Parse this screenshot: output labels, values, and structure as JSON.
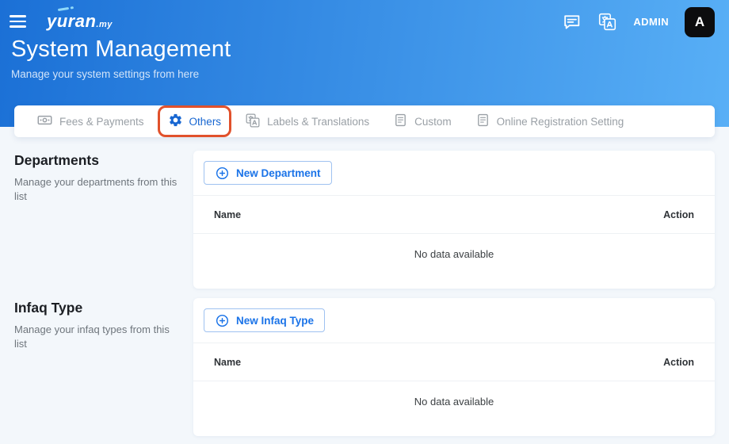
{
  "header": {
    "logo_text": "yuran",
    "logo_suffix": ".my",
    "admin_label": "ADMIN",
    "avatar_letter": "A",
    "title": "System Management",
    "subtitle": "Manage your system settings from here",
    "icons": [
      "hamburger-icon",
      "chat-icon",
      "translate-icon"
    ]
  },
  "tabs": [
    {
      "label": "Fees & Payments",
      "icon": "banknote-icon",
      "active": false
    },
    {
      "label": "Others",
      "icon": "gear-icon",
      "active": true,
      "highlighted": true
    },
    {
      "label": "Labels & Translations",
      "icon": "translate-icon",
      "active": false
    },
    {
      "label": "Custom",
      "icon": "document-icon",
      "active": false
    },
    {
      "label": "Online Registration Setting",
      "icon": "document-icon",
      "active": false
    }
  ],
  "sections": [
    {
      "title": "Departments",
      "description": "Manage your departments from this list",
      "button_label": "New Department",
      "button_icon": "plus-circle-icon",
      "table": {
        "columns": [
          "Name",
          "Action"
        ],
        "empty_text": "No data available"
      }
    },
    {
      "title": "Infaq Type",
      "description": "Manage your infaq types from this list",
      "button_label": "New Infaq Type",
      "button_icon": "plus-circle-icon",
      "table": {
        "columns": [
          "Name",
          "Action"
        ],
        "empty_text": "No data available"
      }
    }
  ],
  "colors": {
    "header_gradient_start": "#1b70d6",
    "header_gradient_end": "#58aff6",
    "accent_blue": "#1a73e8",
    "active_tab_blue": "#1766d1",
    "inactive_tab_gray": "#9aa0a6",
    "highlight_red": "#e1512b",
    "page_background": "#f3f7fb",
    "avatar_background": "#0c0c0e"
  }
}
